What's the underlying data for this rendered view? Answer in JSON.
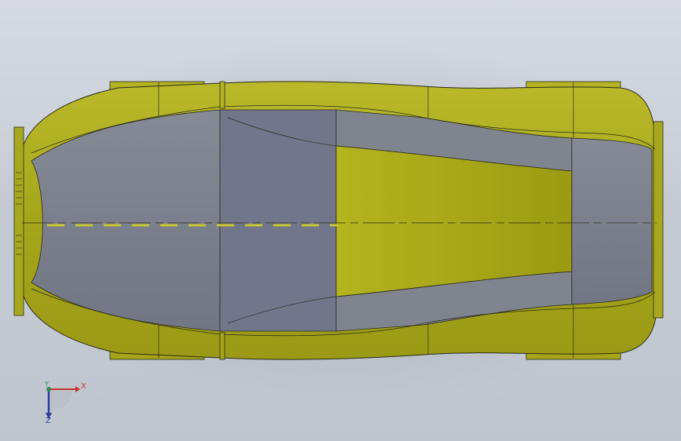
{
  "viewport": {
    "background_top": "#d6dae1",
    "background_bottom": "#bfc5ce"
  },
  "model": {
    "body_color": "#a8a81e",
    "glass_color": "#7e8290",
    "edge_color": "#2b2b1a"
  },
  "triad": {
    "x_label": "X",
    "y_label": "Y",
    "z_label": "Z",
    "x_color": "#c0392b",
    "y_color": "#2e8b57",
    "z_color": "#2c3e9e"
  }
}
